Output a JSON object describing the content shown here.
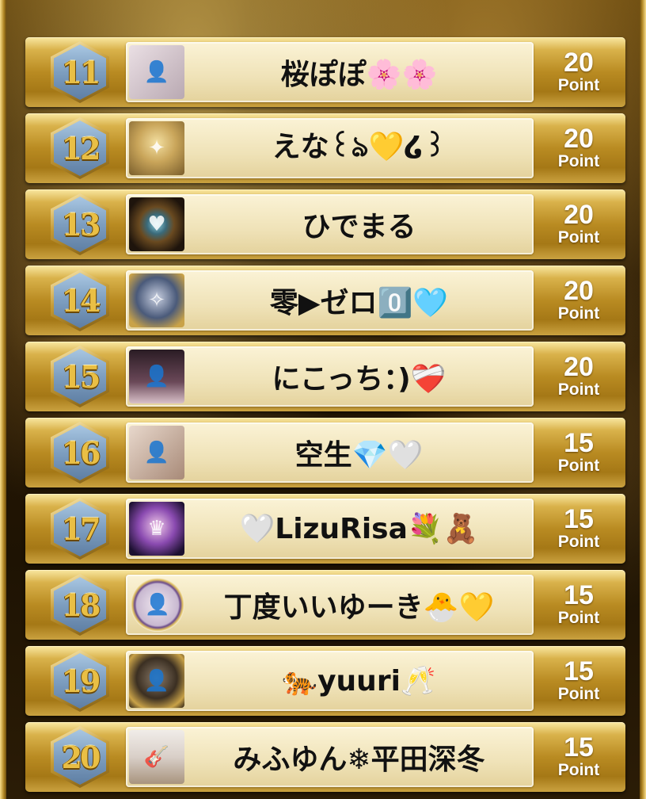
{
  "unit_label": "Point",
  "rows": [
    {
      "rank": "11",
      "name": "桜ぽぽ🌸🌸",
      "points": "20",
      "avatar_icon": "person-photo",
      "avatar_color": "#d9cdd2"
    },
    {
      "rank": "12",
      "name": "えな꒰ঌ💛໒꒱",
      "points": "20",
      "avatar_icon": "angel-illustration",
      "avatar_color": "#c9a55a"
    },
    {
      "rank": "13",
      "name": "ひでまる",
      "points": "20",
      "avatar_icon": "heart-emblem",
      "avatar_color": "#3a2a1c"
    },
    {
      "rank": "14",
      "name": "零▶ゼロ0️⃣🩵",
      "points": "20",
      "avatar_icon": "character-art",
      "avatar_color": "#4a5a7a"
    },
    {
      "rank": "15",
      "name": "にこっち：)❤️‍🩹",
      "points": "20",
      "avatar_icon": "person-photo",
      "avatar_color": "#4a3440"
    },
    {
      "rank": "16",
      "name": "空生💎🤍",
      "points": "15",
      "avatar_icon": "person-photo",
      "avatar_color": "#cbb6a8"
    },
    {
      "rank": "17",
      "name": "🤍LizuRisa💐🧸",
      "points": "15",
      "avatar_icon": "vip-badge",
      "avatar_color": "#5a3a8a"
    },
    {
      "rank": "18",
      "name": "丁度いいゆーき🐣💛",
      "points": "15",
      "avatar_icon": "person-photo",
      "avatar_color": "#d8c8d8"
    },
    {
      "rank": "19",
      "name": "🐅yuuri🥂",
      "points": "15",
      "avatar_icon": "gold-frame-photo",
      "avatar_color": "#3b2f22"
    },
    {
      "rank": "20",
      "name": "みふゆん❄平田深冬",
      "points": "15",
      "avatar_icon": "person-with-guitar",
      "avatar_color": "#d9cfc8"
    }
  ]
}
